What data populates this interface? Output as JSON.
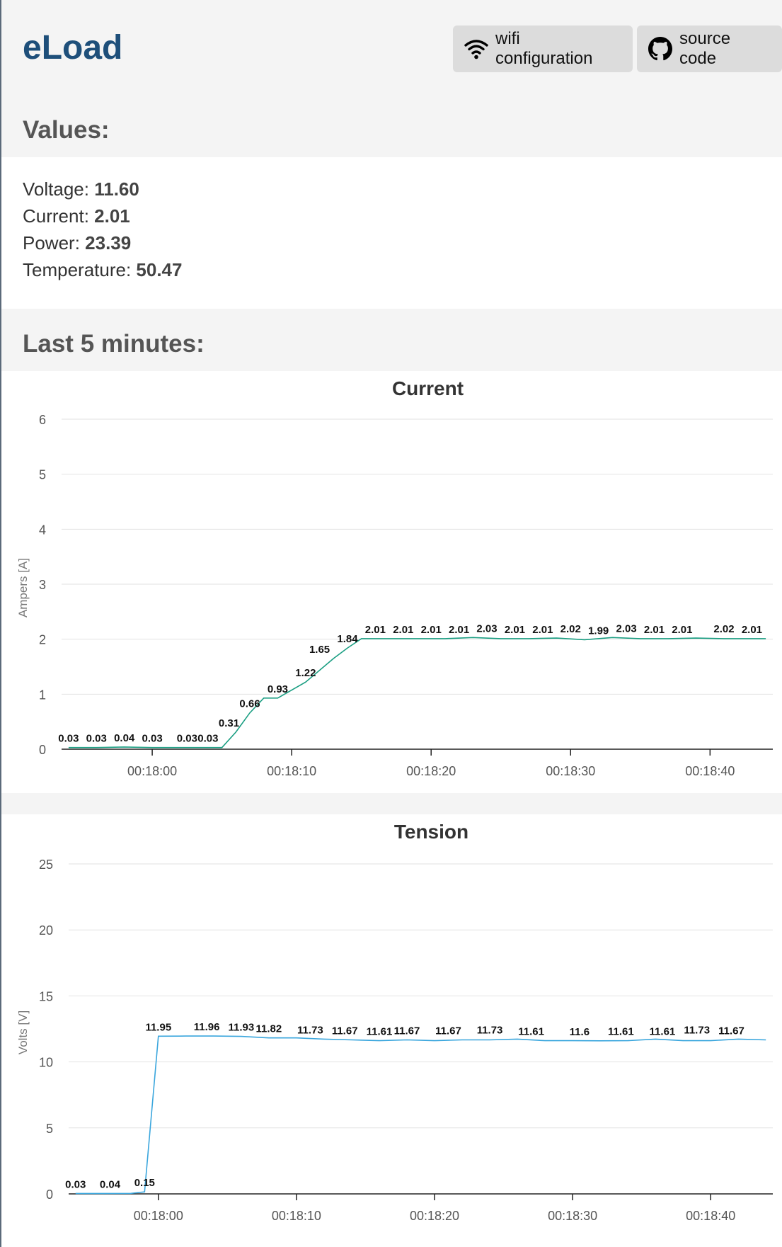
{
  "header": {
    "app_title": "eLoad",
    "wifi_button_label": "wifi configuration",
    "wifi_icon": "wifi-icon",
    "source_button_label": "source code",
    "source_icon": "github-icon"
  },
  "values_section": {
    "title": "Values:",
    "items": [
      {
        "label": "Voltage: ",
        "value": "11.60"
      },
      {
        "label": "Current: ",
        "value": "2.01"
      },
      {
        "label": "Power: ",
        "value": "23.39"
      },
      {
        "label": "Temperature: ",
        "value": "50.47"
      }
    ]
  },
  "history_section": {
    "title": "Last 5 minutes:"
  },
  "chart_data": [
    {
      "type": "line",
      "title": "Current",
      "xlabel": "",
      "ylabel": "Ampers [A]",
      "ylim": [
        0,
        6
      ],
      "yticks": [
        0,
        1,
        2,
        3,
        4,
        5,
        6
      ],
      "xlim": [
        "00:17:53.5",
        "00:18:44.5"
      ],
      "xticks": [
        "00:18:00",
        "00:18:10",
        "00:18:20",
        "00:18:30",
        "00:18:40"
      ],
      "color": "#1a9e82",
      "grid": true,
      "series": [
        {
          "x": [
            "00:17:54",
            "00:17:56",
            "00:17:58",
            "00:18:00",
            "00:18:02",
            "00:18:04",
            "00:18:05",
            "00:18:06",
            "00:18:07",
            "00:18:08",
            "00:18:09",
            "00:18:11",
            "00:18:13",
            "00:18:14",
            "00:18:15",
            "00:18:17",
            "00:18:19",
            "00:18:21",
            "00:18:23",
            "00:18:25",
            "00:18:27",
            "00:18:29",
            "00:18:31",
            "00:18:33",
            "00:18:35",
            "00:18:37",
            "00:18:39",
            "00:18:41",
            "00:18:43",
            "00:18:44"
          ],
          "values": [
            0.03,
            0.03,
            0.04,
            0.03,
            0.03,
            0.03,
            0.03,
            0.31,
            0.66,
            0.93,
            0.93,
            1.22,
            1.65,
            1.84,
            2.01,
            2.01,
            2.01,
            2.01,
            2.03,
            2.01,
            2.01,
            2.02,
            1.99,
            2.03,
            2.01,
            2.01,
            2.02,
            2.01,
            2.01,
            2.01
          ]
        }
      ],
      "data_labels": [
        {
          "x": "00:17:54",
          "text": "0.03",
          "y": 0.03
        },
        {
          "x": "00:17:56",
          "text": "0.03",
          "y": 0.03
        },
        {
          "x": "00:17:58",
          "text": "0.04",
          "y": 0.04
        },
        {
          "x": "00:18:00",
          "text": "0.03",
          "y": 0.03
        },
        {
          "x": "00:18:02.5",
          "text": "0.03",
          "y": 0.03
        },
        {
          "x": "00:18:04",
          "text": "0.03",
          "y": 0.03
        },
        {
          "x": "00:18:05.5",
          "text": "0.31",
          "y": 0.31
        },
        {
          "x": "00:18:07",
          "text": "0.66",
          "y": 0.66
        },
        {
          "x": "00:18:09",
          "text": "0.93",
          "y": 0.93
        },
        {
          "x": "00:18:11",
          "text": "1.22",
          "y": 1.22
        },
        {
          "x": "00:18:12",
          "text": "1.65",
          "y": 1.65
        },
        {
          "x": "00:18:14",
          "text": "1.84",
          "y": 1.84
        },
        {
          "x": "00:18:16",
          "text": "2.01",
          "y": 2.01
        },
        {
          "x": "00:18:18",
          "text": "2.01",
          "y": 2.01
        },
        {
          "x": "00:18:20",
          "text": "2.01",
          "y": 2.01
        },
        {
          "x": "00:18:22",
          "text": "2.01",
          "y": 2.01
        },
        {
          "x": "00:18:24",
          "text": "2.03",
          "y": 2.03
        },
        {
          "x": "00:18:26",
          "text": "2.01",
          "y": 2.01
        },
        {
          "x": "00:18:28",
          "text": "2.01",
          "y": 2.01
        },
        {
          "x": "00:18:30",
          "text": "2.02",
          "y": 2.02
        },
        {
          "x": "00:18:32",
          "text": "1.99",
          "y": 1.99
        },
        {
          "x": "00:18:34",
          "text": "2.03",
          "y": 2.03
        },
        {
          "x": "00:18:36",
          "text": "2.01",
          "y": 2.01
        },
        {
          "x": "00:18:38",
          "text": "2.01",
          "y": 2.01
        },
        {
          "x": "00:18:41",
          "text": "2.02",
          "y": 2.02
        },
        {
          "x": "00:18:43",
          "text": "2.01",
          "y": 2.01
        }
      ]
    },
    {
      "type": "line",
      "title": "Tension",
      "xlabel": "",
      "ylabel": "Volts [V]",
      "ylim": [
        0,
        25
      ],
      "yticks": [
        0,
        5,
        10,
        15,
        20,
        25
      ],
      "xlim": [
        "00:17:53.5",
        "00:18:44.5"
      ],
      "xticks": [
        "00:18:00",
        "00:18:10",
        "00:18:20",
        "00:18:30",
        "00:18:40"
      ],
      "color": "#3aa6dd",
      "grid": true,
      "series": [
        {
          "x": [
            "00:17:54",
            "00:17:56",
            "00:17:58",
            "00:17:59",
            "00:18:00",
            "00:18:02",
            "00:18:04",
            "00:18:06",
            "00:18:08",
            "00:18:10",
            "00:18:12",
            "00:18:14",
            "00:18:16",
            "00:18:18",
            "00:18:20",
            "00:18:22",
            "00:18:24",
            "00:18:26",
            "00:18:28",
            "00:18:30",
            "00:18:32",
            "00:18:34",
            "00:18:36",
            "00:18:38",
            "00:18:40",
            "00:18:42",
            "00:18:44"
          ],
          "values": [
            0.03,
            0.03,
            0.04,
            0.15,
            11.95,
            11.96,
            11.96,
            11.93,
            11.82,
            11.82,
            11.73,
            11.67,
            11.61,
            11.67,
            11.61,
            11.67,
            11.67,
            11.73,
            11.61,
            11.61,
            11.6,
            11.61,
            11.73,
            11.61,
            11.61,
            11.73,
            11.67
          ]
        }
      ],
      "data_labels": [
        {
          "x": "00:17:54",
          "text": "0.03",
          "y": 0.03
        },
        {
          "x": "00:17:56.5",
          "text": "0.04",
          "y": 0.04
        },
        {
          "x": "00:17:59",
          "text": "0.15",
          "y": 0.15
        },
        {
          "x": "00:18:00",
          "text": "11.95",
          "y": 11.95
        },
        {
          "x": "00:18:03.5",
          "text": "11.96",
          "y": 11.96
        },
        {
          "x": "00:18:06",
          "text": "11.93",
          "y": 11.93
        },
        {
          "x": "00:18:08",
          "text": "11.82",
          "y": 11.82
        },
        {
          "x": "00:18:11",
          "text": "11.73",
          "y": 11.73
        },
        {
          "x": "00:18:13.5",
          "text": "11.67",
          "y": 11.67
        },
        {
          "x": "00:18:16",
          "text": "11.61",
          "y": 11.61
        },
        {
          "x": "00:18:18",
          "text": "11.67",
          "y": 11.67
        },
        {
          "x": "00:18:21",
          "text": "11.67",
          "y": 11.67
        },
        {
          "x": "00:18:24",
          "text": "11.73",
          "y": 11.73
        },
        {
          "x": "00:18:27",
          "text": "11.61",
          "y": 11.61
        },
        {
          "x": "00:18:30.5",
          "text": "11.6",
          "y": 11.6
        },
        {
          "x": "00:18:33.5",
          "text": "11.61",
          "y": 11.61
        },
        {
          "x": "00:18:36.5",
          "text": "11.61",
          "y": 11.61
        },
        {
          "x": "00:18:39",
          "text": "11.73",
          "y": 11.73
        },
        {
          "x": "00:18:41.5",
          "text": "11.67",
          "y": 11.67
        }
      ]
    }
  ]
}
